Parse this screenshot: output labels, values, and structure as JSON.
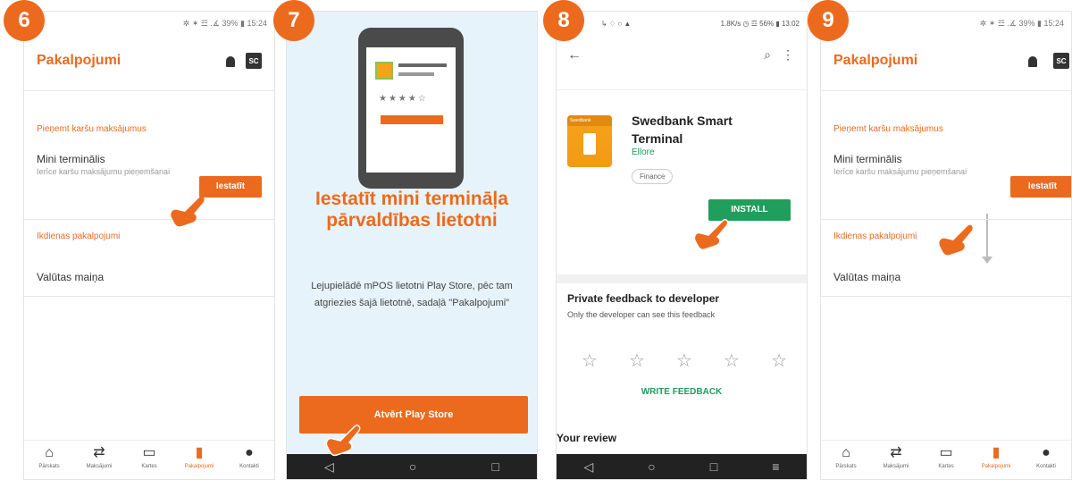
{
  "colors": {
    "accent": "#ec6a1d",
    "play_green": "#1f9e5c"
  },
  "steps": [
    "6",
    "7",
    "8",
    "9"
  ],
  "status_left_p8": "↳ ♢ ○ ▲",
  "status_right": "✲ ✶ ☲ .∡ 39% ▮ 15:24",
  "status_right_p8": "1.8K/s ◷ ☲ 56% ▮ 13:02",
  "app_title": "Pakalpojumi",
  "sc_label": "SC",
  "section_card": "Pieņemt karšu maksājumus",
  "item_terminal_title": "Mini terminālis",
  "item_terminal_sub": "Ierīce karšu maksājumu pieņemšanai",
  "btn_setup": "Iestatīt",
  "section_daily": "Ikdienas pakalpojumi",
  "item_currency": "Valūtas maiņa",
  "tabs": [
    {
      "icon": "home-icon",
      "label": "Pārskats"
    },
    {
      "icon": "transfer-icon",
      "label": "Maksājumi"
    },
    {
      "icon": "card-icon",
      "label": "Kartes"
    },
    {
      "icon": "terminal-icon",
      "label": "Pakalpojumi"
    },
    {
      "icon": "chat-icon",
      "label": "Kontakti"
    }
  ],
  "p7_title": "Iestatīt mini termināļa pārvaldības lietotni",
  "p7_text": "Lejupielādē mPOS lietotni Play Store, pēc tam atgriezies šajā lietotnē, sadaļā \"Pakalpojumi\"",
  "p7_button": "Atvērt Play Store",
  "p8_app_name": "Swedbank Smart Terminal",
  "p8_developer": "Ellore",
  "p8_category": "Finance",
  "p8_install": "INSTALL",
  "p8_icon_band": "Swedbank",
  "p8_feedback_title": "Private feedback to developer",
  "p8_feedback_sub": "Only the developer can see this feedback",
  "p8_write_feedback": "WRITE FEEDBACK",
  "p8_your_review": "Your review",
  "nav_back": "◁",
  "nav_home": "○",
  "nav_recent": "□",
  "nav_extra": "≡"
}
